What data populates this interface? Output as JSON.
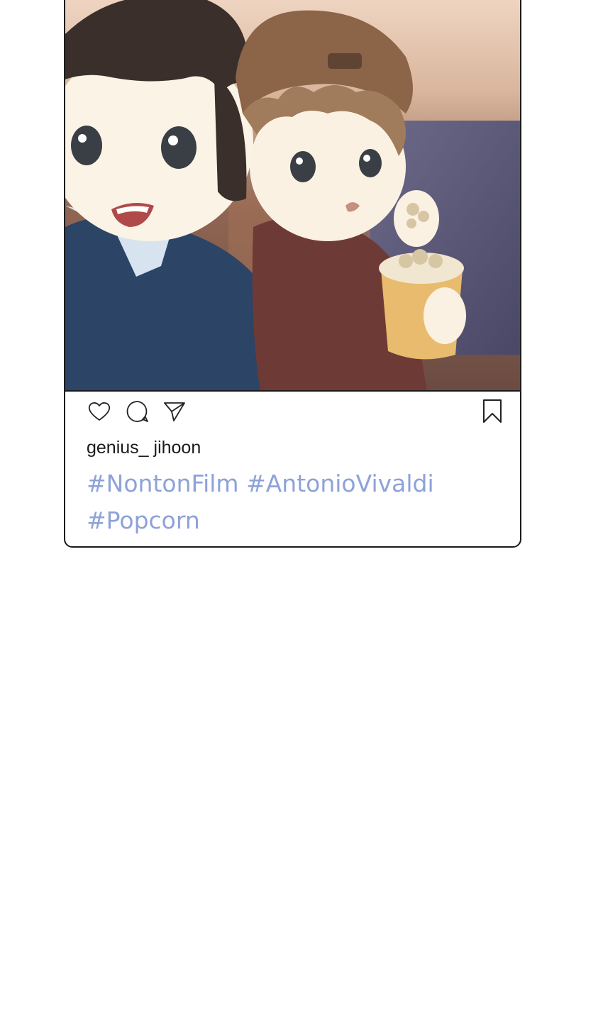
{
  "post": {
    "username": "genius_ jihoon",
    "hashtags": [
      "#NontonFilm",
      "#AntonioVivaldi",
      "#Popcorn"
    ],
    "image": {
      "description_icon": "illustration-two-kids-popcorn-icon"
    },
    "actions": {
      "like_icon": "heart-icon",
      "comment_icon": "speech-bubble-icon",
      "share_icon": "paper-plane-icon",
      "save_icon": "bookmark-icon"
    }
  },
  "colors": {
    "hashtag": "#8ea2d9",
    "border": "#1b1b1b",
    "background": "#ffffff"
  }
}
